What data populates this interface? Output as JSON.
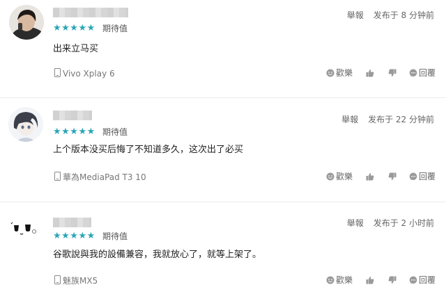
{
  "reviews": [
    {
      "rating_label": "期待值",
      "stars": "★★★★★",
      "rating": 5,
      "report_label": "舉報",
      "posted": "发布于 8 分钟前",
      "content": "出来立马买",
      "device": "Vivo Xplay 6",
      "fun_label": "歡樂",
      "reply_label": "回覆"
    },
    {
      "rating_label": "期待值",
      "stars": "★★★★★",
      "rating": 5,
      "report_label": "舉報",
      "posted": "发布于 22 分钟前",
      "content": "上个版本没买后悔了不知道多久，这次出了必买",
      "device": "華為MediaPad T3 10",
      "fun_label": "歡樂",
      "reply_label": "回覆"
    },
    {
      "rating_label": "期待值",
      "stars": "★★★★★",
      "rating": 5,
      "report_label": "舉報",
      "posted": "发布于 2 小时前",
      "content": "谷歌說與我的設備兼容，我就放心了，就等上架了。",
      "device": "魅族MX5",
      "fun_label": "歡樂",
      "reply_label": "回覆"
    }
  ],
  "colors": {
    "star": "#2aa5b5",
    "divider": "#ececec",
    "meta_text": "#666666"
  },
  "icons": [
    "phone-icon",
    "smile-icon",
    "thumbs-up-icon",
    "thumbs-down-icon",
    "reply-icon"
  ]
}
